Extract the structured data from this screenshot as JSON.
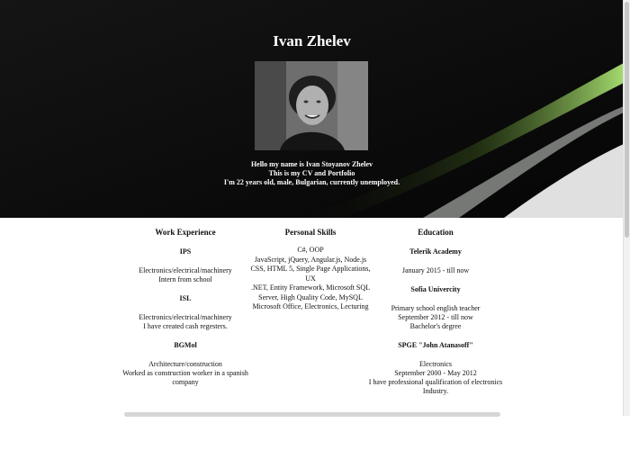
{
  "header": {
    "name": "Ivan Zhelev",
    "intro_lines": [
      "Hello my name is Ivan Stoyanov Zhelev",
      "This is my CV and Portfolio",
      "I'm 22 years old, male, Bulgarian, currently unemployed."
    ],
    "photo_icon": "portrait-photo"
  },
  "work": {
    "title": "Work Experience",
    "entries": [
      {
        "company": "IPS",
        "field": "Electronics/electrical/machinery",
        "desc": "Intern from school"
      },
      {
        "company": "ISL",
        "field": "Electronics/electrical/machinery",
        "desc": "I have created cash regesters."
      },
      {
        "company": "BGMol",
        "field": "Architecture/construction",
        "desc": "Worked as construction worker in a spanish company"
      }
    ]
  },
  "skills": {
    "title": "Personal Skills",
    "lines": [
      "C#, OOP",
      "JavaScript, jQuery, Angular.js, Node.js",
      "CSS, HTML 5, Single Page Applications,",
      "UX",
      ".NET, Entity Framework, Microsoft SQL",
      "Server, High Quality Code, MySQL",
      "Microsoft Office, Electronics, Lecturing"
    ]
  },
  "education": {
    "title": "Education",
    "entries": [
      {
        "school": "Telerik Academy",
        "lines": [
          "January 2015 - till now"
        ]
      },
      {
        "school": "Sofia Univercity",
        "lines": [
          "Primary school english teacher",
          "September 2012 - till now",
          "Bachelor's degree"
        ]
      },
      {
        "school": "SPGE \"John Atanasoff\"",
        "lines": [
          "Electronics",
          "September 2000 - May 2012",
          "I have professional qualification of electronics Industry."
        ]
      }
    ]
  }
}
